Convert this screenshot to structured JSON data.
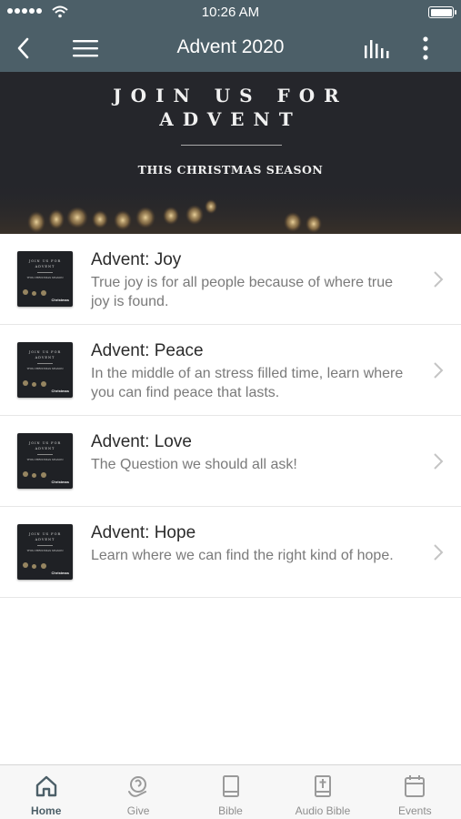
{
  "status_bar": {
    "time": "10:26 AM",
    "signal_icon": "signal-dots-icon",
    "wifi_icon": "wifi-icon",
    "battery_icon": "battery-full-icon"
  },
  "nav": {
    "title": "Advent 2020",
    "back_icon": "chevron-left-icon",
    "menu_icon": "hamburger-menu-icon",
    "audio_icon": "audio-bars-icon",
    "more_icon": "more-vertical-icon",
    "background_color": "#4c5f68"
  },
  "banner": {
    "line1": "JOIN US FOR",
    "line2": "ADVENT",
    "subtitle": "THIS CHRISTMAS SEASON"
  },
  "items": [
    {
      "title": "Advent: Joy",
      "description": "True joy is for all people because of where true joy is found."
    },
    {
      "title": "Advent: Peace",
      "description": "In the middle of an stress filled time, learn where you can find peace that lasts."
    },
    {
      "title": "Advent: Love",
      "description": "The Question we should all ask!"
    },
    {
      "title": "Advent: Hope",
      "description": "Learn where we can find the right kind of hope."
    }
  ],
  "thumbnail": {
    "line1": "JOIN US FOR",
    "line2": "ADVENT",
    "line3": "THIS CHRISTMAS SEASON",
    "logo": "Christmas"
  },
  "tabs": [
    {
      "label": "Home",
      "icon": "home-icon",
      "active": true
    },
    {
      "label": "Give",
      "icon": "give-icon",
      "active": false
    },
    {
      "label": "Bible",
      "icon": "book-icon",
      "active": false
    },
    {
      "label": "Audio Bible",
      "icon": "bible-cross-icon",
      "active": false
    },
    {
      "label": "Events",
      "icon": "calendar-icon",
      "active": false
    }
  ]
}
